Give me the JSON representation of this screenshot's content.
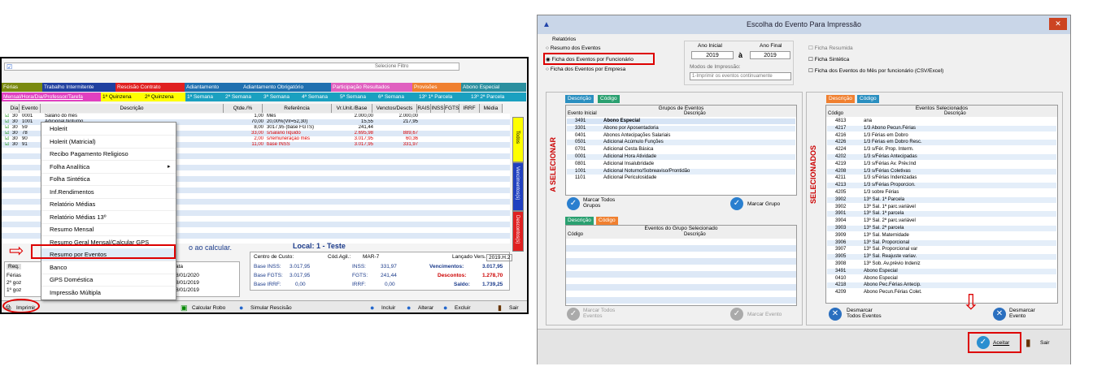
{
  "left": {
    "top_tabs": [
      "Férias",
      "Trabalho Intermitente",
      "Rescisão Contrato",
      "Adiantamento",
      "Adiantamento Obrigatório",
      "Participação Resultados",
      "Provisões",
      "Abono Especial"
    ],
    "sub_tabs": [
      "Mensal/Hora/Dia/Professor/Tarefa",
      "1ª Quinzena",
      "2ª Quinzena",
      "1ª Semana",
      "2ª Semana",
      "3ª Semana",
      "4ª Semana",
      "5ª Semana",
      "6ª Semana",
      "13º 1ª Parcela",
      "13º 2ª Parcela"
    ],
    "headers": [
      "Dia",
      "Evento",
      "Descrição",
      "Qtde./%",
      "Referência",
      "Vr.Unit./Base",
      "Venctos/Descts",
      "RAIS",
      "INSS",
      "FGTS",
      "IRRF",
      "Média"
    ],
    "rows": [
      {
        "d": "30",
        "e": "0001",
        "desc": "Salário do mês",
        "q": "1,00",
        "ref": "Mês",
        "vu": "2.000,00",
        "vd": "2.000,00"
      },
      {
        "d": "30",
        "e": "1001",
        "desc": "Adicional Noturno",
        "q": "70,00",
        "ref": "20,00%(Vlr=52,30)",
        "vu": "15,55",
        "vd": "217,95"
      },
      {
        "d": "30",
        "e": "59",
        "desc": "",
        "q": "8,00",
        "ref": "3017,95 (base FGTS)",
        "vu": "241,44",
        "vd": ""
      },
      {
        "d": "30",
        "e": "78",
        "desc": "",
        "q": "33,00",
        "ref": "s/salário líquido",
        "vu": "2.695,98",
        "vd": "889,67"
      },
      {
        "d": "30",
        "e": "90",
        "desc": "",
        "q": "2,00",
        "ref": "s/remuneração mês",
        "vu": "3.017,95",
        "vd": "60,36"
      },
      {
        "d": "30",
        "e": "91",
        "desc": "",
        "q": "11,00",
        "ref": "base INSS",
        "vu": "3.017,95",
        "vd": "331,97"
      }
    ],
    "side_tabs": [
      "Todos",
      "Vencimentos(s)",
      "Descontos(s)"
    ],
    "menu": [
      "Holerit",
      "Holerit (Matricial)",
      "Recibo Pagamento Religioso",
      "Folha Analítica",
      "Folha Sintética",
      "Inf.Rendimentos",
      "Relatório Médias",
      "Relatório Médias 13º",
      "Resumo Mensal",
      "Resumo Geral Mensal/Calcular GPS",
      "Resumo por Eventos",
      "Banco",
      "GPS Doméstica",
      "Impressão Múltipla"
    ],
    "local": "Local: 1 - Teste",
    "centro": "Centro de Custo:",
    "cod_agil": "Cód.Agil.:",
    "cod_val": "MAR-7",
    "lancado": "Lançado Vers.:",
    "versao": "2019.H.2",
    "calc_text": "o ao calcular.",
    "base_inss_l": "Base INSS:",
    "base_inss": "3.017,95",
    "inss_l": "INSS:",
    "inss": "331,97",
    "base_fgts_l": "Base FGTS:",
    "base_fgts": "3.017,95",
    "fgts_l": "FGTS:",
    "fgts": "241,44",
    "base_irrf_l": "Base IRRF:",
    "base_irrf": "0,00",
    "irrf_l": "IRRF:",
    "irrf": "0,00",
    "venc_l": "Vencimentos:",
    "venc": "3.017,95",
    "desc_l": "Descontos:",
    "desc": "1.278,70",
    "saldo_l": "Saldo:",
    "saldo": "1.739,25",
    "mini_head": [
      "Req.",
      "ata"
    ],
    "mini_rows": [
      [
        "Férias",
        "8/01/2020"
      ],
      [
        "2º goz",
        "8/01/2019"
      ],
      [
        "1º goz",
        "8/01/2019"
      ]
    ],
    "bottom": [
      "Imprimir",
      "Calcular Robo",
      "Simular Rescisão",
      "Incluir",
      "Alterar",
      "Excluir",
      "Sair"
    ],
    "top_input": "Selecione Filtro"
  },
  "right": {
    "title": "Escolha do Evento Para Impressão",
    "relatorios": "Relatórios",
    "radios": [
      "Resumo dos Eventos",
      "Ficha dos Eventos por Funcionário",
      "Ficha dos Eventos por Empresa"
    ],
    "ano_ini_l": "Ano Inicial",
    "ano_ini": "2019",
    "a": "à",
    "ano_fim_l": "Ano Final",
    "ano_fim": "2019",
    "modos_l": "Modos de Impressão:",
    "modo": "1-Imprimir os eventos continuamente",
    "checks": [
      "Ficha Resumida",
      "Ficha Sintética",
      "Ficha dos Eventos do Mês por funcionário (CSV/Excel)"
    ],
    "tab_desc": "Descrição",
    "tab_cod": "Código",
    "grupos_title": "Grupos de Eventos",
    "col_evento": "Evento Inicial",
    "col_desc": "Descrição",
    "grupos": [
      [
        "3491",
        "Abono Especial"
      ],
      [
        "3301",
        "Abono por Aposentadoria"
      ],
      [
        "0401",
        "Abonos Antecipações Salariais"
      ],
      [
        "0501",
        "Adicional Acúmulo Funções"
      ],
      [
        "0701",
        "Adicional Cesta Básica"
      ],
      [
        "0001",
        "Adicional Hora Atividade"
      ],
      [
        "0801",
        "Adicional Insalubridade"
      ],
      [
        "1001",
        "Adicional Noturno/Sobreaviso/Prontidão"
      ],
      [
        "1101",
        "Adicional Periculosidade"
      ]
    ],
    "marcar_todos_grupos": "Marcar Todos Grupos",
    "marcar_grupo": "Marcar Grupo",
    "eventos_grupo_title": "Eventos do Grupo Selecionado",
    "col_codigo": "Código",
    "a_selecionar": "A SELECIONAR",
    "selecionados": "SELECIONADOS",
    "marcar_todos_eventos": "Marcar Todos Eventos",
    "marcar_evento": "Marcar Evento",
    "sel_title": "Eventos Selecionados",
    "selecionados_rows": [
      [
        "4813",
        "ana"
      ],
      [
        "4217",
        "1/3 Abono Pecun.Férias"
      ],
      [
        "4216",
        "1/3 Férias em Dobro"
      ],
      [
        "4226",
        "1/3 Férias em Dobro Resc."
      ],
      [
        "4224",
        "1/3 s/Fér. Prop. Interm."
      ],
      [
        "4202",
        "1/3 s/Férias Antecipadas"
      ],
      [
        "4219",
        "1/3 s/Férias Av. Prév.Ind"
      ],
      [
        "4208",
        "1/3 s/Férias Coletivas"
      ],
      [
        "4211",
        "1/3 s/Férias Indenizadas"
      ],
      [
        "4213",
        "1/3 s/Férias Proporcion."
      ],
      [
        "4205",
        "1/3 sobre Férias"
      ],
      [
        "3902",
        "13º Sal. 1ª Parcela"
      ],
      [
        "3902",
        "13º Sal. 1ª parc.variável"
      ],
      [
        "3901",
        "13º Sal. 1ª parcela"
      ],
      [
        "3904",
        "13º Sal. 2ª parc.variável"
      ],
      [
        "3903",
        "13º Sal. 2ª parcela"
      ],
      [
        "3909",
        "13º Sal. Maternidade"
      ],
      [
        "3906",
        "13º Sal. Proporcional"
      ],
      [
        "3907",
        "13º Sal. Proporcional var"
      ],
      [
        "3905",
        "13º Sal. Reajuste variav."
      ],
      [
        "3908",
        "13º Sob. Av.prévio Indeniz"
      ],
      [
        "3491",
        "Abono Especial"
      ],
      [
        "0410",
        "Abono Especial"
      ],
      [
        "4218",
        "Abono Pec.Férias Antecip."
      ],
      [
        "4209",
        "Abono Pecun.Férias Colet."
      ]
    ],
    "desmarcar_todos": "Desmarcar Todos Eventos",
    "desmarcar_evento": "Desmarcar Evento",
    "aceitar": "Aceitar",
    "sair": "Sair"
  }
}
